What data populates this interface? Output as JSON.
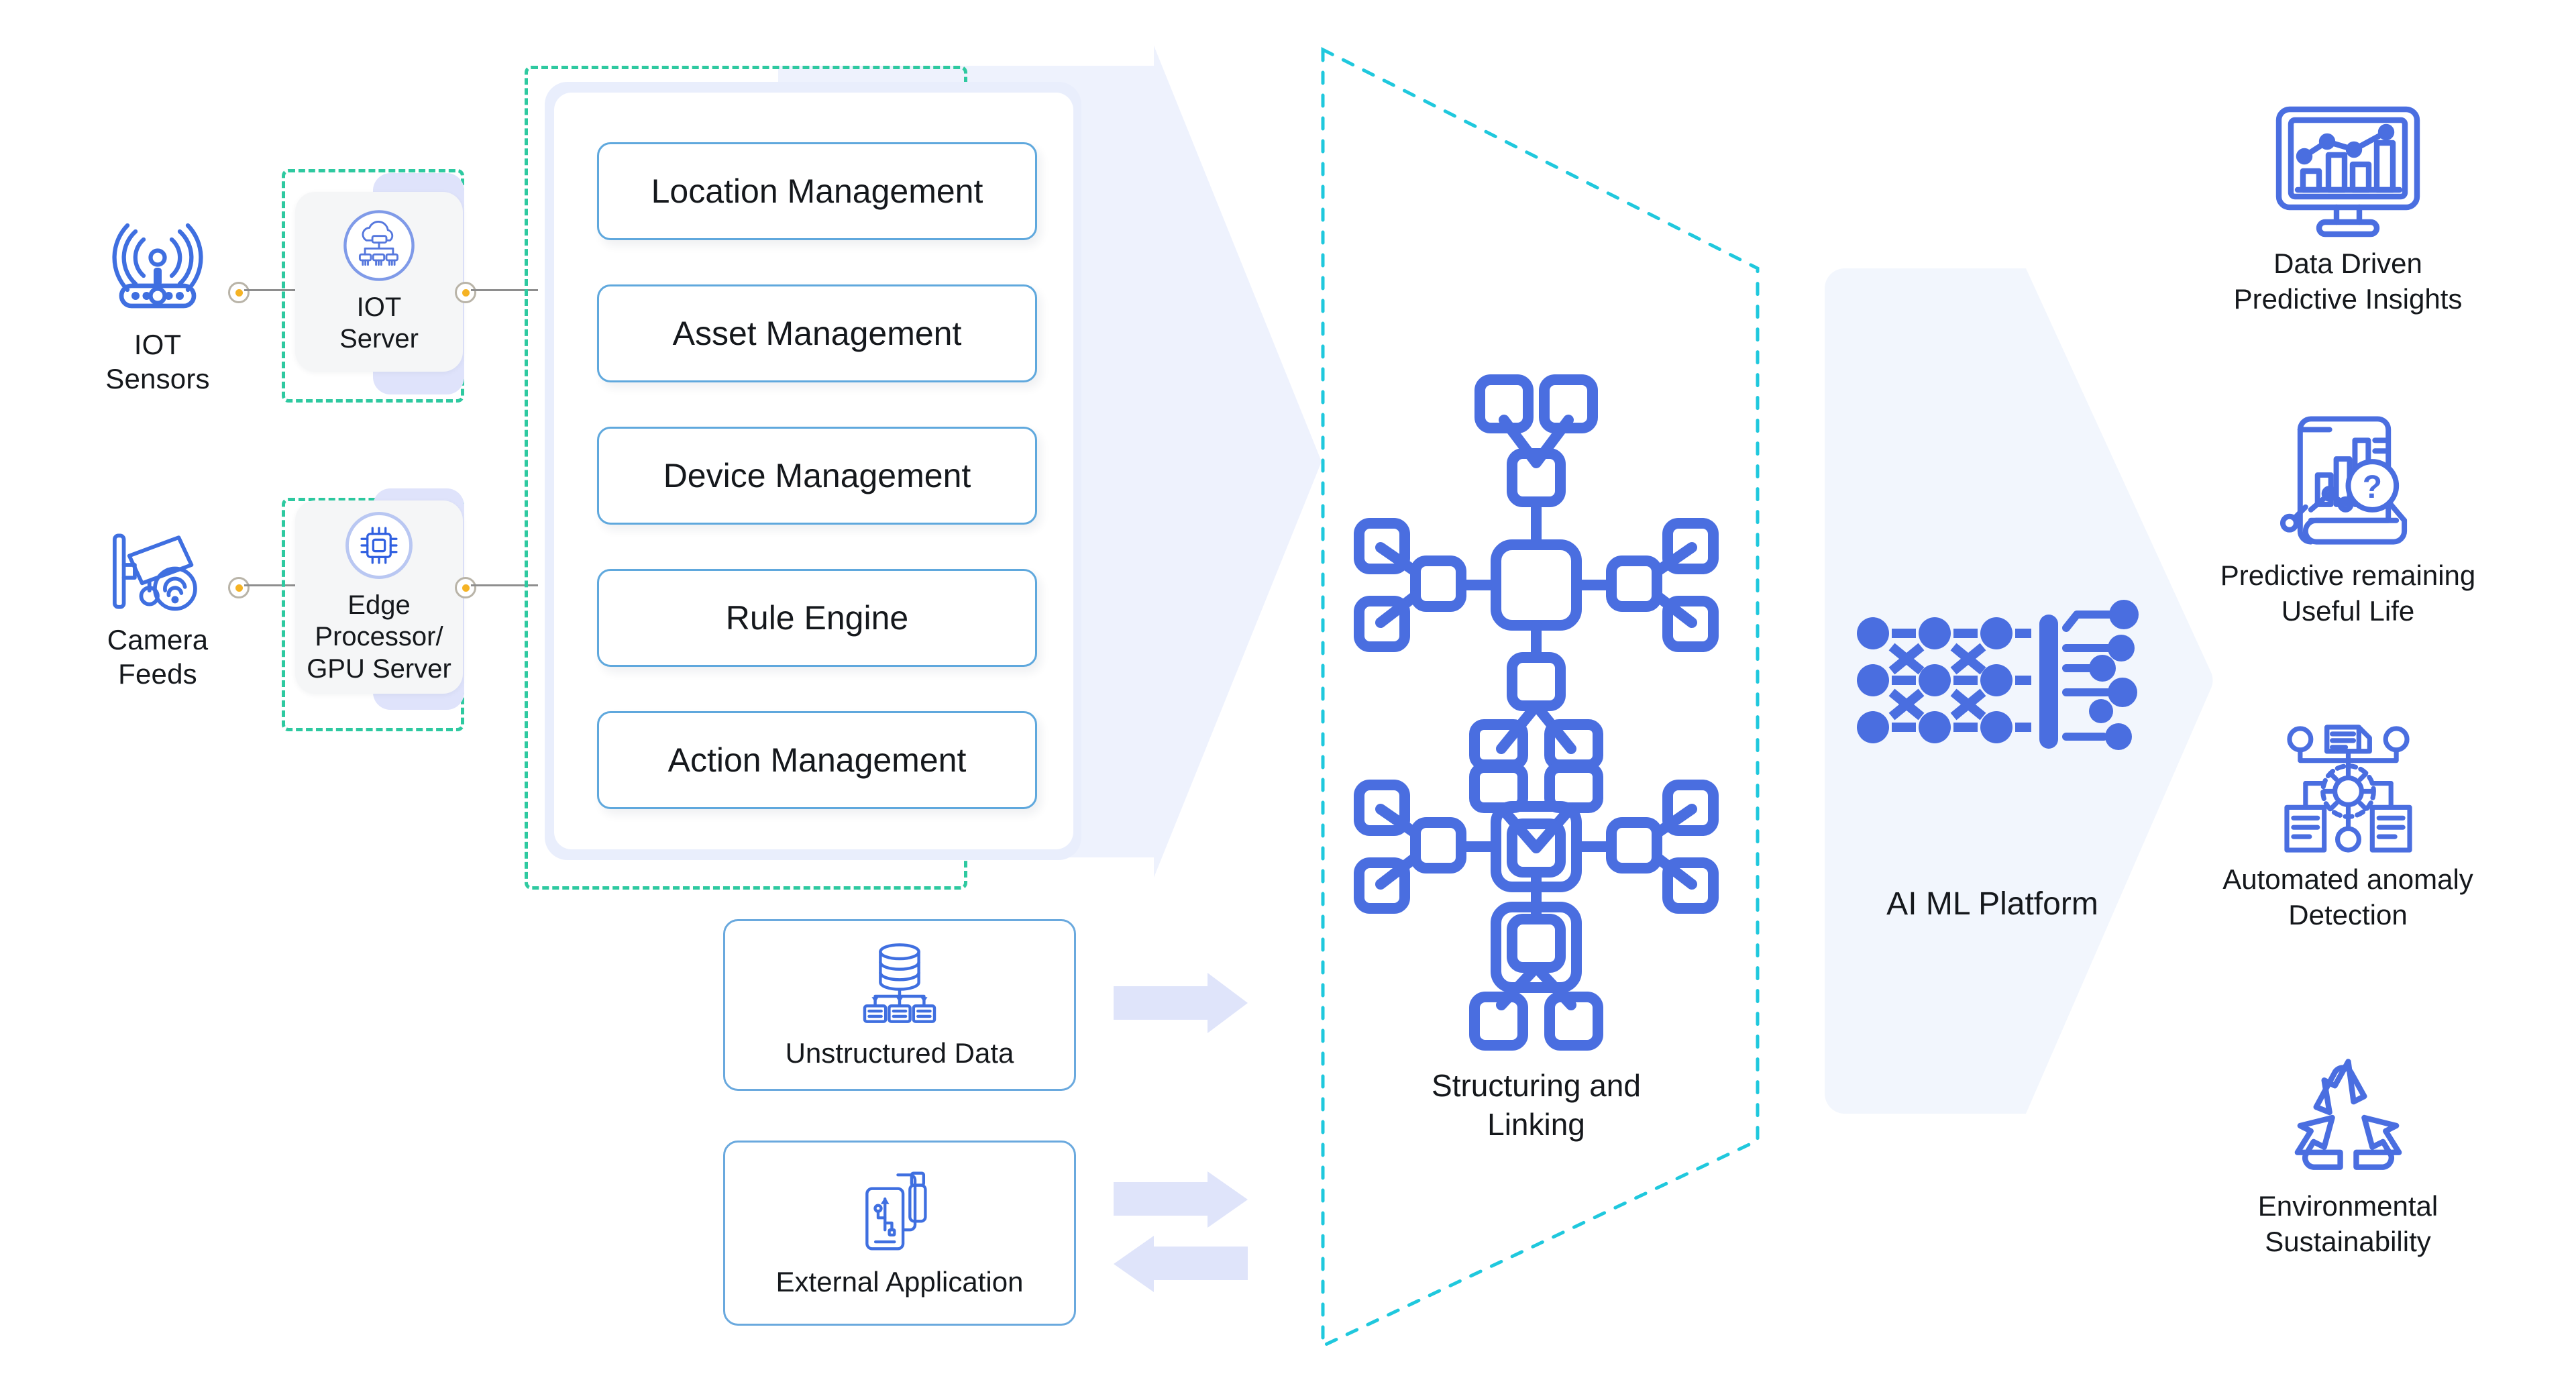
{
  "sources": [
    {
      "id": "iot-sensors",
      "label": "IOT\nSensors",
      "label_line1": "IOT",
      "label_line2": "Sensors",
      "icon": "antenna-sensor-icon"
    },
    {
      "id": "camera-feeds",
      "label": "Camera\nFeeds",
      "label_line1": "Camera",
      "label_line2": "Feeds",
      "icon": "cctv-camera-icon"
    }
  ],
  "servers": [
    {
      "id": "iot-server",
      "label_line1": "IOT",
      "label_line2": "Server",
      "label_line3": "",
      "icon": "cloud-server-icon"
    },
    {
      "id": "edge-server",
      "label_line1": "Edge",
      "label_line2": "Processor/",
      "label_line3": "GPU Server",
      "icon": "cpu-chip-icon"
    }
  ],
  "management": {
    "items": [
      {
        "label": "Location Management"
      },
      {
        "label": "Asset Management"
      },
      {
        "label": "Device Management"
      },
      {
        "label": "Rule Engine"
      },
      {
        "label": "Action Management"
      }
    ]
  },
  "inputs": [
    {
      "id": "unstructured-data",
      "label": "Unstructured Data",
      "icon": "database-tree-icon",
      "arrow": "single-right"
    },
    {
      "id": "external-application",
      "label": "External Application",
      "icon": "usb-device-icon",
      "arrow": "bidirectional"
    }
  ],
  "middle": {
    "id": "structuring-and-linking",
    "label_line1": "Structuring and",
    "label_line2": "Linking",
    "icon": "network-graph-icon"
  },
  "platform": {
    "id": "ai-ml-platform",
    "label": "AI ML Platform",
    "icon": "neural-network-icon"
  },
  "outcomes": [
    {
      "id": "data-driven-predictive-insights",
      "line1": "Data Driven",
      "line2": "Predictive Insights",
      "icon": "monitor-chart-icon"
    },
    {
      "id": "predictive-remaining-useful-life",
      "line1": "Predictive remaining",
      "line2": "Useful Life",
      "icon": "report-magnifier-icon"
    },
    {
      "id": "automated-anomaly-detection",
      "line1": "Automated anomaly",
      "line2": "Detection",
      "icon": "gear-documents-icon"
    },
    {
      "id": "environmental-sustainability",
      "line1": "Environmental",
      "line2": "Sustainability",
      "icon": "recycle-icon"
    }
  ],
  "colors": {
    "brand_blue": "#4a6ee0",
    "icon_blue": "#3f6fe0",
    "dashed_green": "#2ec9a0",
    "dashed_cyan": "#1fc8dd",
    "lavender": "#dfe3fb",
    "pale_blue": "#eef2fd",
    "card_border": "#5fa8dd",
    "connector_dot": "#f5b324",
    "text": "#15181c"
  }
}
